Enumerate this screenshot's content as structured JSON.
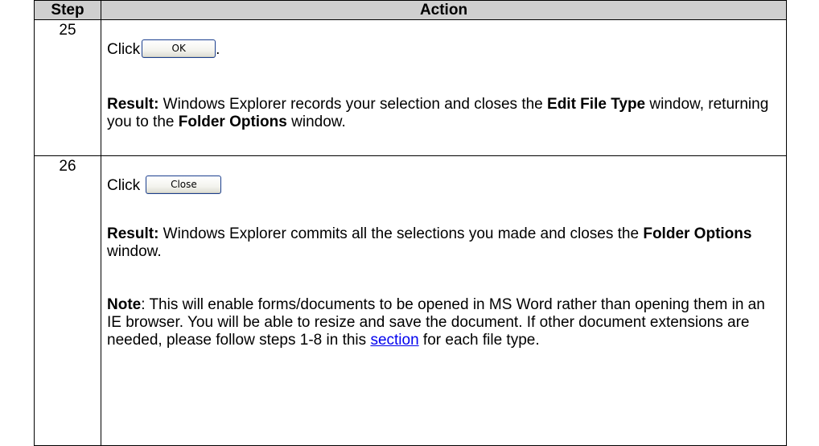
{
  "table": {
    "headers": {
      "step": "Step",
      "action": "Action"
    },
    "rows": [
      {
        "step": "25",
        "click_label": "Click",
        "button_label": "OK",
        "trailing": ".",
        "result_label": "Result:",
        "result_text_1": " Windows Explorer records your selection and closes the ",
        "result_bold_1": "Edit File Type",
        "result_text_2": " window, returning you to the ",
        "result_bold_2": "Folder Options",
        "result_text_3": " window."
      },
      {
        "step": "26",
        "click_label": "Click",
        "button_label": "Close",
        "result_label": "Result:",
        "result_text_1": " Windows Explorer commits all the selections you made and closes the ",
        "result_bold_1": "Folder Options",
        "result_text_2": " window.",
        "note_label": "Note",
        "note_text_1": ":  This will enable forms/documents to be opened in MS Word rather than opening them in an IE browser. You will be able to resize and save the document.  If other document extensions are needed, please follow steps 1-8 in this ",
        "note_link": "section",
        "note_text_2": " for each file type."
      }
    ]
  }
}
